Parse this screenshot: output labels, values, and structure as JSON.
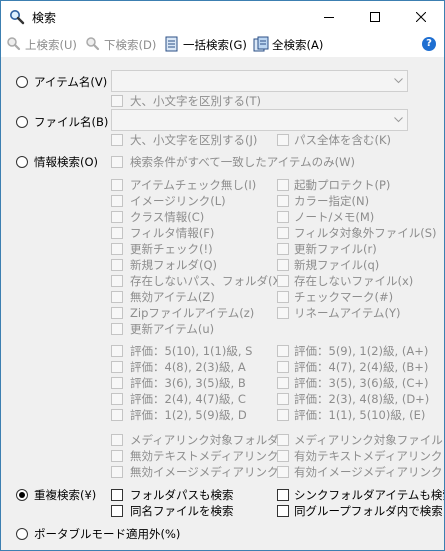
{
  "window": {
    "title": "検索"
  },
  "toolbar": {
    "prev": "上検索(U)",
    "next": "下検索(D)",
    "batch": "一括検索(G)",
    "all": "全検索(A)",
    "help": "?"
  },
  "modes": {
    "item_name": "アイテム名(V)",
    "file_name": "ファイル名(B)",
    "info_search": "情報検索(O)",
    "duplicate_search": "重複検索(¥)",
    "portable_mode": "ポータブルモード適用外(%)",
    "selected": "duplicate_search"
  },
  "item_name_options": {
    "case_sensitive": "大、小文字を区別する(T)"
  },
  "file_name_options": {
    "case_sensitive": "大、小文字を区別する(J)",
    "full_path": "パス全体を含む(K)"
  },
  "info_options": {
    "all_match": "検索条件がすべて一致したアイテムのみ(W)",
    "left": [
      "アイテムチェック無し(I)",
      "イメージリンク(L)",
      "クラス情報(C)",
      "フィルタ情報(F)",
      "更新チェック(!)",
      "新規フォルダ(Q)",
      "存在しないパス、フォルダ(X)",
      "無効アイテム(Z)",
      "Zipファイルアイテム(z)",
      "更新アイテム(u)"
    ],
    "right": [
      "起動プロテクト(P)",
      "カラー指定(N)",
      "ノート/メモ(M)",
      "フィルタ対象外ファイル(S)",
      "更新ファイル(r)",
      "新規ファイル(q)",
      "存在しないファイル(x)",
      "チェックマーク(#)",
      "リネームアイテム(Y)"
    ],
    "ratings_left": [
      "評価：5(10), 1(1)級, S",
      "評価：4(8), 2(3)級, A",
      "評価：3(6), 3(5)級, B",
      "評価：2(4), 4(7)級, C",
      "評価：1(2), 5(9)級, D"
    ],
    "ratings_right": [
      "評価：5(9), 1(2)級, (A+)",
      "評価：4(7), 2(4)級, (B+)",
      "評価：3(5), 3(6)級, (C+)",
      "評価：2(3), 4(8)級, (D+)",
      "評価：1(1), 5(10)級, (E)"
    ],
    "media_left": [
      "メディアリンク対象フォルダ",
      "無効テキストメディアリンク",
      "無効イメージメディアリンク"
    ],
    "media_right": [
      "メディアリンク対象ファイル",
      "有効テキストメディアリンク",
      "有効イメージメディアリンク"
    ]
  },
  "duplicate_options": {
    "folder_path": "フォルダパスも検索",
    "same_name": "同名ファイルを検索",
    "sync_folder": "シンクフォルダアイテムも検索",
    "same_group": "同グループフォルダ内で検索"
  }
}
